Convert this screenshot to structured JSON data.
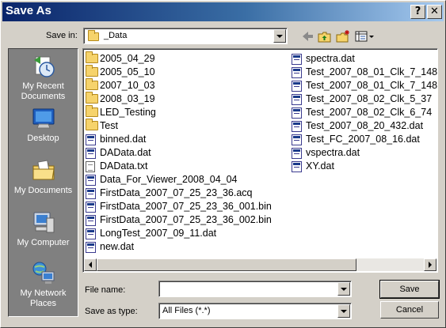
{
  "window": {
    "title": "Save As"
  },
  "titlebar": {
    "help_glyph": "?",
    "close_glyph": "✕"
  },
  "toolbar": {
    "save_in_label": "Save in:",
    "save_in_value": "_Data"
  },
  "places": [
    {
      "label": "My Recent Documents",
      "icon": "recent-documents-icon"
    },
    {
      "label": "Desktop",
      "icon": "desktop-icon"
    },
    {
      "label": "My Documents",
      "icon": "my-documents-icon"
    },
    {
      "label": "My Computer",
      "icon": "my-computer-icon"
    },
    {
      "label": "My Network Places",
      "icon": "network-places-icon"
    }
  ],
  "files": {
    "column1": [
      {
        "name": "2005_04_29",
        "type": "folder"
      },
      {
        "name": "2005_05_10",
        "type": "folder"
      },
      {
        "name": "2007_10_03",
        "type": "folder"
      },
      {
        "name": "2008_03_19",
        "type": "folder"
      },
      {
        "name": "LED_Testing",
        "type": "folder"
      },
      {
        "name": "Test",
        "type": "folder"
      },
      {
        "name": "binned.dat",
        "type": "dat"
      },
      {
        "name": "DAData.dat",
        "type": "dat"
      },
      {
        "name": "DAData.txt",
        "type": "txt"
      },
      {
        "name": "Data_For_Viewer_2008_04_04",
        "type": "dat"
      },
      {
        "name": "FirstData_2007_07_25_23_36.acq",
        "type": "dat"
      },
      {
        "name": "FirstData_2007_07_25_23_36_001.bin",
        "type": "dat"
      },
      {
        "name": "FirstData_2007_07_25_23_36_002.bin",
        "type": "dat"
      },
      {
        "name": "LongTest_2007_09_11.dat",
        "type": "dat"
      },
      {
        "name": "new.dat",
        "type": "dat"
      }
    ],
    "column2": [
      {
        "name": "spectra.dat",
        "type": "dat"
      },
      {
        "name": "Test_2007_08_01_Clk_7_148",
        "type": "dat"
      },
      {
        "name": "Test_2007_08_01_Clk_7_148",
        "type": "dat"
      },
      {
        "name": "Test_2007_08_02_Clk_5_37",
        "type": "dat"
      },
      {
        "name": "Test_2007_08_02_Clk_6_74",
        "type": "dat"
      },
      {
        "name": "Test_2007_08_20_432.dat",
        "type": "dat"
      },
      {
        "name": "Test_FC_2007_08_16.dat",
        "type": "dat"
      },
      {
        "name": "vspectra.dat",
        "type": "dat"
      },
      {
        "name": "XY.dat",
        "type": "dat"
      }
    ]
  },
  "form": {
    "file_name_label": "File name:",
    "file_name_value": "",
    "save_as_type_label": "Save as type:",
    "save_as_type_value": "All Files (*.*)"
  },
  "buttons": {
    "save": "Save",
    "cancel": "Cancel"
  }
}
